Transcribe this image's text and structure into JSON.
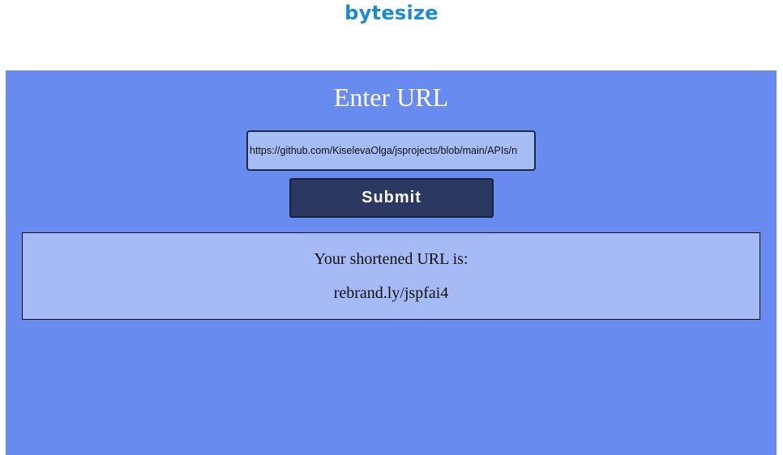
{
  "header": {
    "logo_text": "bytesize",
    "logo_color": "#1b8ad6"
  },
  "main": {
    "title": "Enter URL",
    "background_color": "#678bef",
    "url_input": {
      "value": "https://github.com/KiselevaOlga/jsprojects/blob/main/APIs/n"
    },
    "submit_label": "Submit",
    "result": {
      "label": "Your shortened URL is:",
      "short_url": "rebrand.ly/jspfai4"
    }
  }
}
